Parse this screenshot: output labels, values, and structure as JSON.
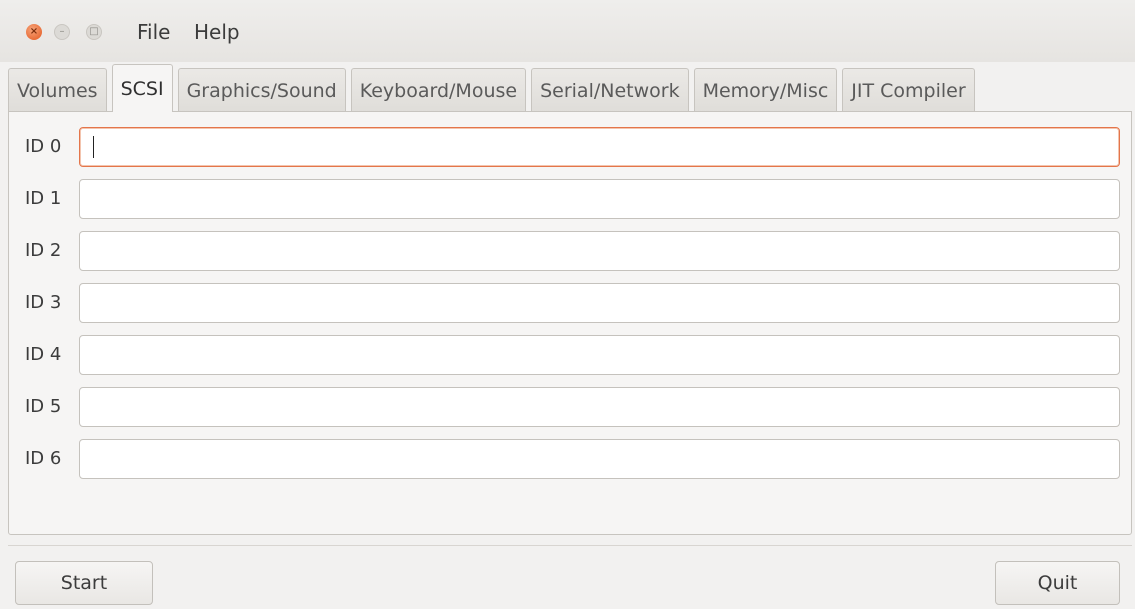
{
  "menubar": {
    "items": [
      "File",
      "Help"
    ]
  },
  "window_controls": {
    "close_glyph": "×",
    "minimize_glyph": "–",
    "maximize_glyph": "□"
  },
  "tabs": [
    {
      "label": "Volumes",
      "active": false
    },
    {
      "label": "SCSI",
      "active": true
    },
    {
      "label": "Graphics/Sound",
      "active": false
    },
    {
      "label": "Keyboard/Mouse",
      "active": false
    },
    {
      "label": "Serial/Network",
      "active": false
    },
    {
      "label": "Memory/Misc",
      "active": false
    },
    {
      "label": "JIT Compiler",
      "active": false
    }
  ],
  "scsi": {
    "rows": [
      {
        "label": "ID 0",
        "value": "",
        "focused": true
      },
      {
        "label": "ID 1",
        "value": "",
        "focused": false
      },
      {
        "label": "ID 2",
        "value": "",
        "focused": false
      },
      {
        "label": "ID 3",
        "value": "",
        "focused": false
      },
      {
        "label": "ID 4",
        "value": "",
        "focused": false
      },
      {
        "label": "ID 5",
        "value": "",
        "focused": false
      },
      {
        "label": "ID 6",
        "value": "",
        "focused": false
      }
    ]
  },
  "buttons": {
    "start_label": "Start",
    "quit_label": "Quit"
  },
  "colors": {
    "focus_border": "#e4754a",
    "close_button": "#e2571e"
  }
}
